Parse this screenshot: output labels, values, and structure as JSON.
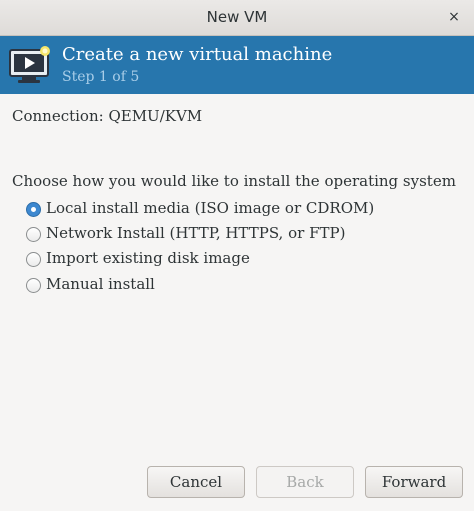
{
  "window": {
    "title": "New VM",
    "close_glyph": "×"
  },
  "banner": {
    "icon": "virtual-machine-icon",
    "heading": "Create a new virtual machine",
    "step": "Step 1 of 5",
    "color": "#2776ad"
  },
  "connection": {
    "text": "Connection: QEMU/KVM"
  },
  "install": {
    "prompt": "Choose how you would like to install the operating system",
    "options": [
      {
        "label": "Local install media (ISO image or CDROM)",
        "selected": true
      },
      {
        "label": "Network Install (HTTP, HTTPS, or FTP)",
        "selected": false
      },
      {
        "label": "Import existing disk image",
        "selected": false
      },
      {
        "label": "Manual install",
        "selected": false
      }
    ]
  },
  "buttons": {
    "cancel": "Cancel",
    "back": "Back",
    "forward": "Forward"
  }
}
